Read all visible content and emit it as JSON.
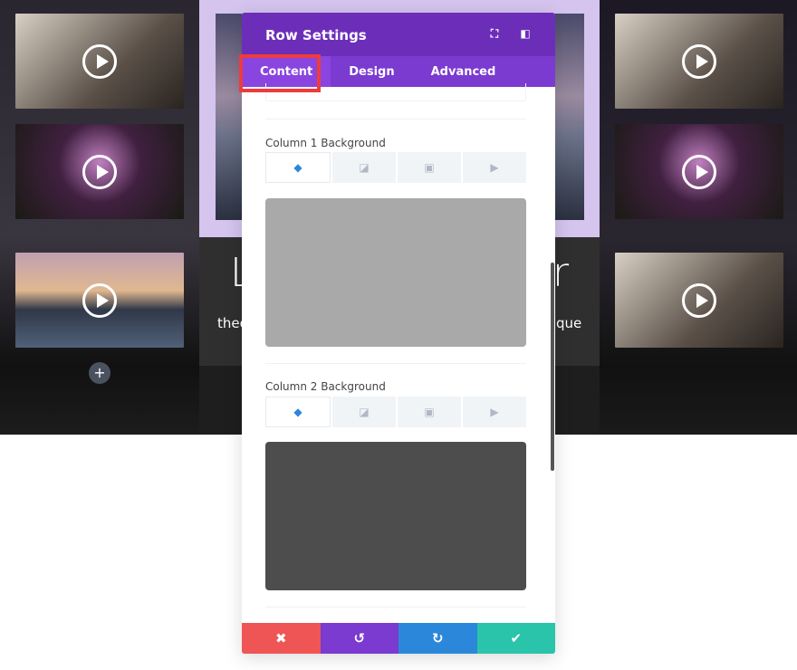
{
  "background_page": {
    "heading_left": "L",
    "heading_right": "r",
    "text_left": "theo",
    "text_right": "que",
    "add_label": "+"
  },
  "modal": {
    "title": "Row Settings",
    "header_icons": [
      "fullscreen-icon",
      "split-view-icon"
    ],
    "tabs": [
      {
        "label": "Content",
        "active": true
      },
      {
        "label": "Design",
        "active": false
      },
      {
        "label": "Advanced",
        "active": false
      }
    ],
    "sections": [
      {
        "label": "Column 1 Background",
        "swatch_color": "#a9a9a9",
        "bg_tabs": [
          "color",
          "gradient",
          "image",
          "video"
        ]
      },
      {
        "label": "Column 2 Background",
        "swatch_color": "#4d4d4d",
        "bg_tabs": [
          "color",
          "gradient",
          "image",
          "video"
        ]
      }
    ],
    "footer": {
      "cancel": {
        "icon": "✖",
        "color": "#ef5555"
      },
      "undo": {
        "icon": "↺",
        "color": "#7b3ad0"
      },
      "redo": {
        "icon": "↻",
        "color": "#2b87da"
      },
      "save": {
        "icon": "✔",
        "color": "#29c4a9"
      }
    }
  },
  "colors": {
    "header": "#6c2eb9",
    "tabs": "#7b3ad0",
    "highlight": "#ef3b3b"
  }
}
